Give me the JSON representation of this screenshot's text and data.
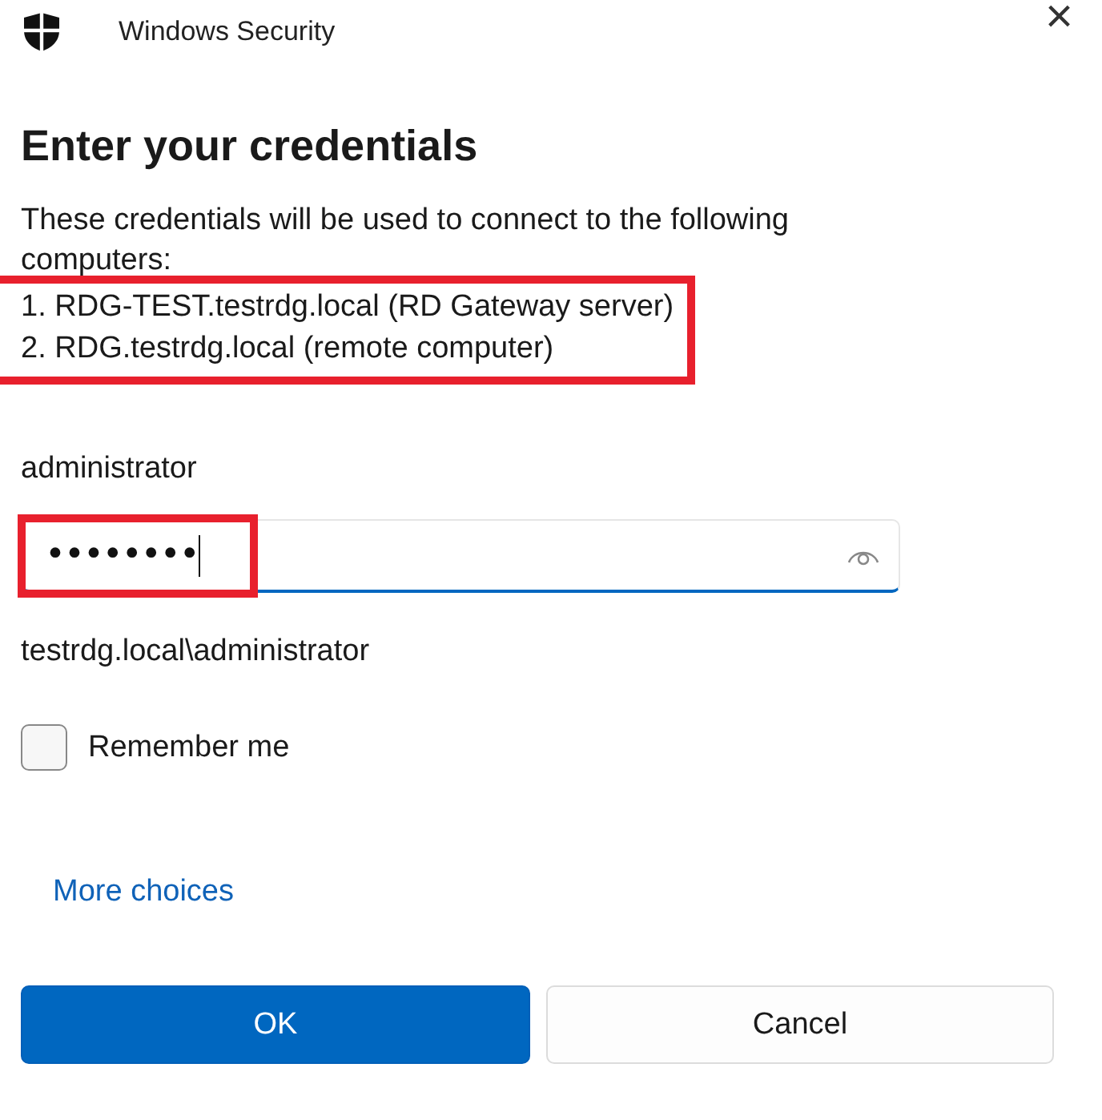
{
  "window": {
    "title": "Windows Security",
    "close": "×"
  },
  "heading": "Enter your credentials",
  "intro": "These credentials will be used to connect to the following computers:",
  "computers": {
    "highlighted": true,
    "items": [
      "1. RDG-TEST.testrdg.local (RD Gateway server)",
      "2. RDG.testrdg.local (remote computer)"
    ]
  },
  "username": "administrator",
  "password": {
    "value": "••••••••",
    "focused": true,
    "highlighted": true
  },
  "domain_user": "testrdg.local\\administrator",
  "remember_me": {
    "label": "Remember me",
    "checked": false
  },
  "more_choices": "More choices",
  "buttons": [
    {
      "label": "OK",
      "kind": "primary"
    },
    {
      "label": "Cancel",
      "kind": "secondary"
    }
  ]
}
